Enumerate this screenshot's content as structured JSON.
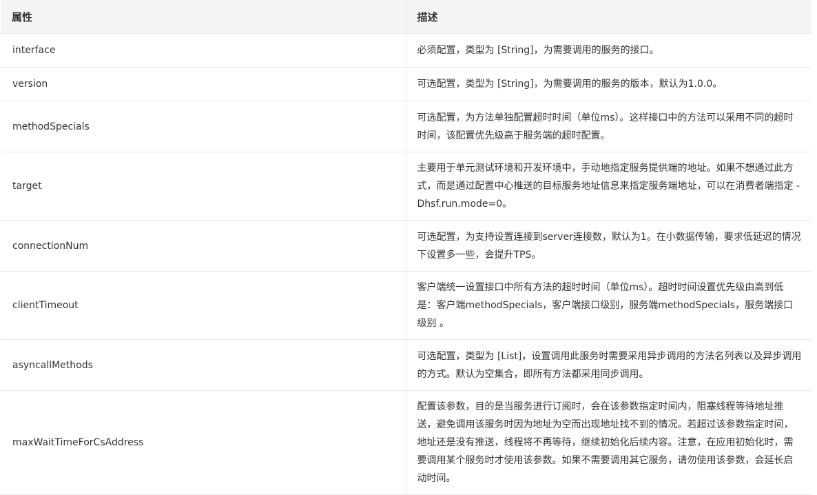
{
  "table": {
    "headers": [
      "属性",
      "描述"
    ],
    "rows": [
      {
        "property": "interface",
        "description": "必须配置，类型为 [String]，为需要调用的服务的接口。"
      },
      {
        "property": "version",
        "description": "可选配置，类型为 [String]，为需要调用的服务的版本，默认为1.0.0。"
      },
      {
        "property": "methodSpecials",
        "description": "可选配置，为方法单独配置超时时间（单位ms）。这样接口中的方法可以采用不同的超时时间，该配置优先级高于服务端的超时配置。"
      },
      {
        "property": "target",
        "description": "主要用于单元测试环境和开发环境中，手动地指定服务提供端的地址。如果不想通过此方式，而是通过配置中心推送的目标服务地址信息来指定服务端地址，可以在消费者端指定 -Dhsf.run.mode=0。"
      },
      {
        "property": "connectionNum",
        "description": "可选配置，为支持设置连接到server连接数，默认为1。在小数据传输，要求低延迟的情况下设置多一些，会提升TPS。"
      },
      {
        "property": "clientTimeout",
        "description": "客户端统一设置接口中所有方法的超时时间（单位ms）。超时时间设置优先级由高到低是：客户端methodSpecials，客户端接口级别，服务端methodSpecials，服务端接口级别 。"
      },
      {
        "property": "asyncallMethods",
        "description": "可选配置，类型为 [List]，设置调用此服务时需要采用异步调用的方法名列表以及异步调用的方式。默认为空集合，即所有方法都采用同步调用。"
      },
      {
        "property": "maxWaitTimeForCsAddress",
        "description": "配置该参数，目的是当服务进行订阅时，会在该参数指定时间内，阻塞线程等待地址推送，避免调用该服务时因为地址为空而出现地址找不到的情况。若超过该参数指定时间，地址还是没有推送，线程将不再等待，继续初始化后续内容。注意，在应用初始化时，需要调用某个服务时才使用该参数。如果不需要调用其它服务，请勿使用该参数，会延长启动时间。"
      }
    ]
  }
}
